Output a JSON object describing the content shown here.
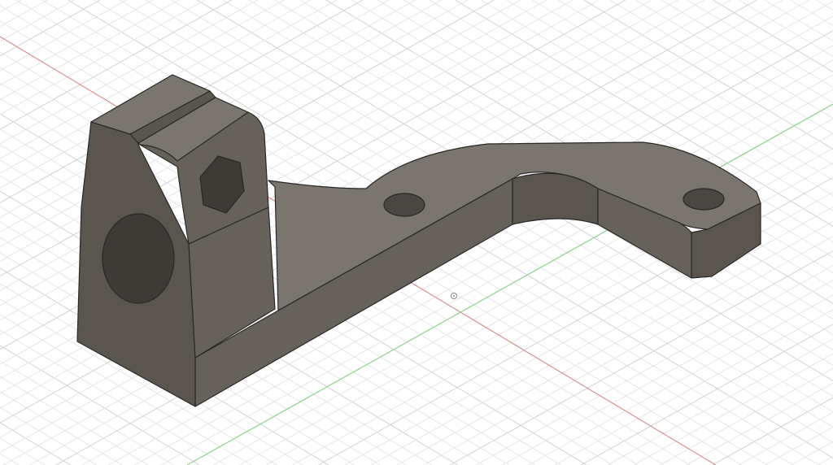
{
  "viewport": {
    "background": "#ffffff",
    "grid_minor_color": "#e6e6e6",
    "grid_major_color": "#d2d2d2",
    "axis_x_color": "#e08080",
    "axis_y_color": "#80d080",
    "part_colors": {
      "top": "#7a766f",
      "front": "#66625b",
      "side": "#5a564f",
      "dark": "#3e3b37",
      "hole": "#4a4742"
    }
  },
  "icons": {
    "origin": "origin-point-icon"
  }
}
